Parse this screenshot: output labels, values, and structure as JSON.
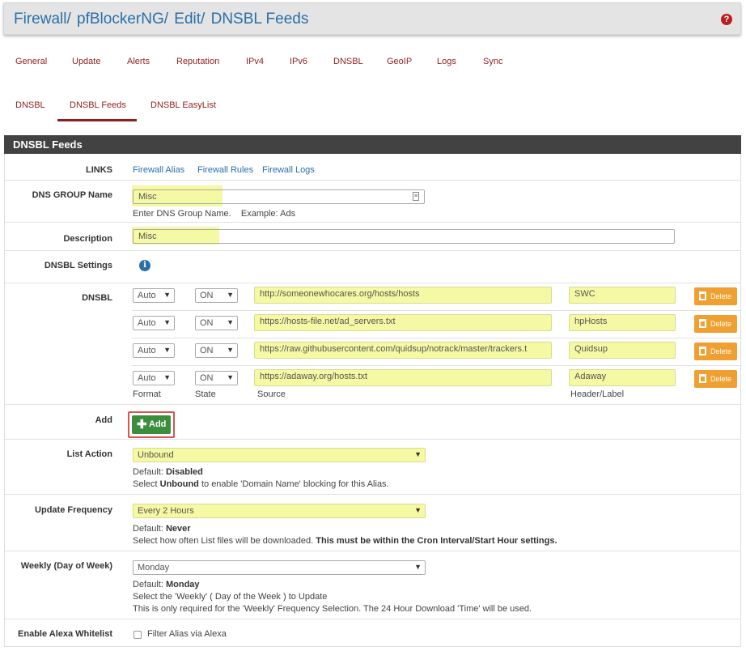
{
  "breadcrumb": [
    "Firewall",
    "pfBlockerNG",
    "Edit",
    "DNSBL Feeds"
  ],
  "breadcrumb_sep": "/",
  "help_icon": "?",
  "tabs_primary": [
    "General",
    "Update",
    "Alerts",
    "Reputation",
    "IPv4",
    "IPv6",
    "DNSBL",
    "GeoIP",
    "Logs",
    "Sync"
  ],
  "tabs_secondary": [
    "DNSBL",
    "DNSBL Feeds",
    "DNSBL EasyList"
  ],
  "tabs_secondary_active": "DNSBL Feeds",
  "panel_title": "DNSBL Feeds",
  "links": {
    "label": "LINKS",
    "items": [
      "Firewall Alias",
      "Firewall Rules",
      "Firewall Logs"
    ]
  },
  "dns_group": {
    "label": "DNS GROUP Name",
    "value": "Misc",
    "help": "Enter DNS Group Name.    Example: Ads"
  },
  "description": {
    "label": "Description",
    "value": "Misc"
  },
  "dnsbl_settings": {
    "label": "DNSBL Settings",
    "icon": "info-icon"
  },
  "dnsbl": {
    "label": "DNSBL",
    "rows": [
      {
        "format": "Auto",
        "state": "ON",
        "source": "http://someonewhocares.org/hosts/hosts",
        "header": "SWC",
        "delete": "Delete"
      },
      {
        "format": "Auto",
        "state": "ON",
        "source": "https://hosts-file.net/ad_servers.txt",
        "header": "hpHosts",
        "delete": "Delete"
      },
      {
        "format": "Auto",
        "state": "ON",
        "source": "https://raw.githubusercontent.com/quidsup/notrack/master/trackers.t",
        "header": "Quidsup",
        "delete": "Delete"
      },
      {
        "format": "Auto",
        "state": "ON",
        "source": "https://adaway.org/hosts.txt",
        "header": "Adaway",
        "delete": "Delete"
      }
    ],
    "col_labels": {
      "format": "Format",
      "state": "State",
      "source": "Source",
      "header": "Header/Label"
    }
  },
  "add": {
    "label": "Add",
    "button": "Add"
  },
  "list_action": {
    "label": "List Action",
    "value": "Unbound",
    "default_prefix": "Default:",
    "default_value": "Disabled",
    "help_pre": "Select ",
    "help_bold": "Unbound",
    "help_post": " to enable 'Domain Name' blocking for this Alias."
  },
  "update_frequency": {
    "label": "Update Frequency",
    "value": "Every 2 Hours",
    "default_prefix": "Default:",
    "default_value": "Never",
    "help_pre": "Select how often List files will be downloaded. ",
    "help_bold": "This must be within the Cron Interval/Start Hour settings."
  },
  "weekly": {
    "label": "Weekly (Day of Week)",
    "value": "Monday",
    "default_prefix": "Default:",
    "default_value": "Monday",
    "help1": "Select the 'Weekly' ( Day of the Week ) to Update",
    "help2": "This is only required for the 'Weekly' Frequency Selection. The 24 Hour Download 'Time' will be used."
  },
  "alexa": {
    "label": "Enable Alexa Whitelist",
    "checkbox_label": "Filter Alias via Alexa",
    "checked": false
  },
  "colors": {
    "accent_red": "#8f1f1f",
    "link_blue": "#2a6fa8",
    "highlight": "#f6f9a4",
    "delete_orange": "#f0a030",
    "add_green": "#3b8e3b"
  }
}
